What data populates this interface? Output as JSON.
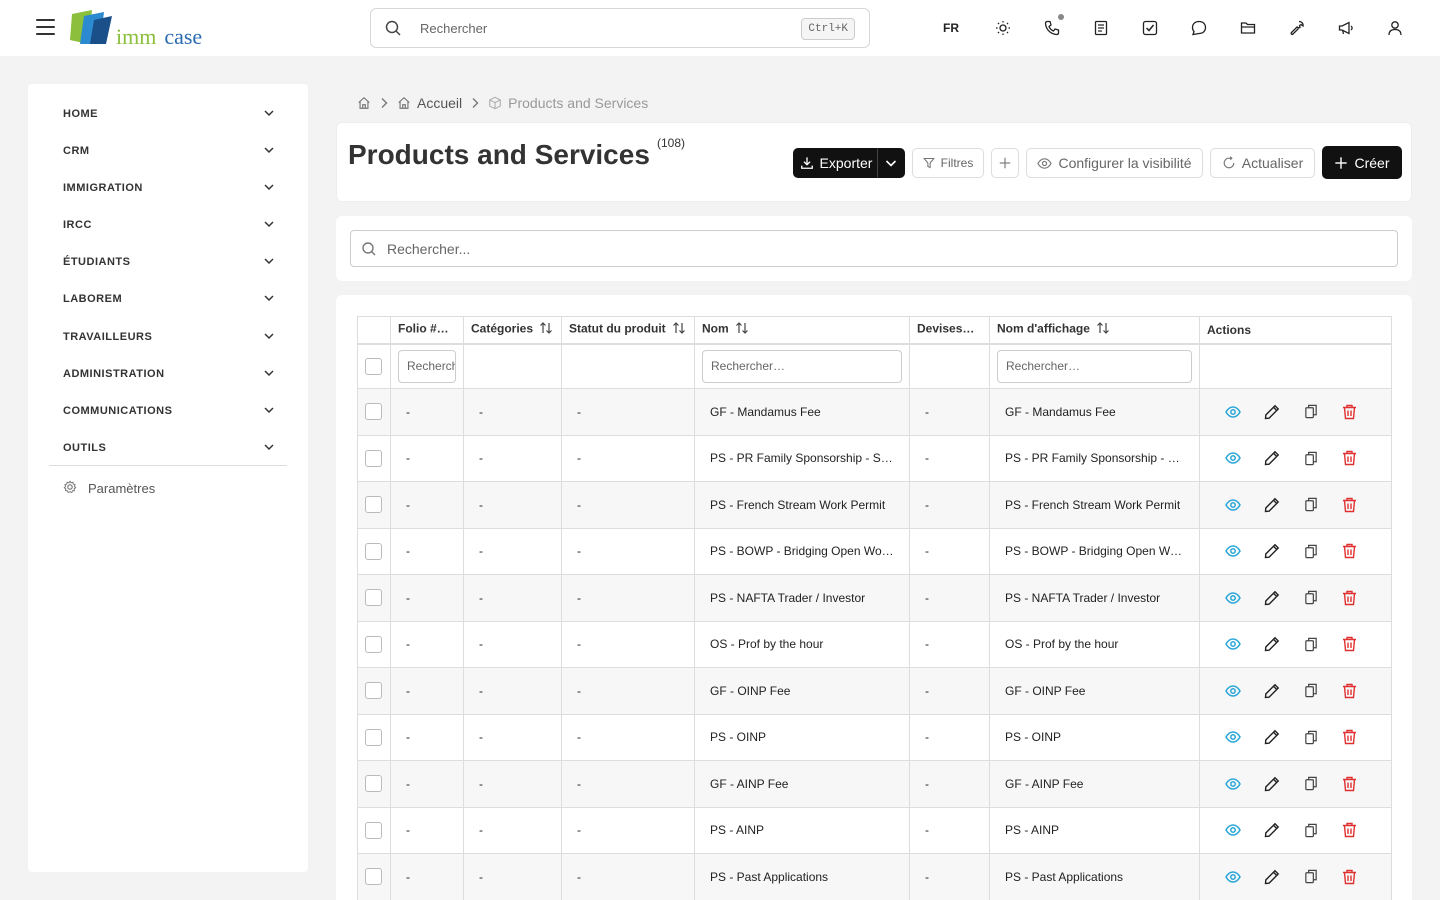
{
  "app": {
    "logo": {
      "part1": "imm",
      "part2": "case"
    },
    "search_placeholder": "Rechercher",
    "search_shortcut": "Ctrl+K",
    "language": "FR"
  },
  "sidebar": {
    "items": [
      {
        "label": "HOME"
      },
      {
        "label": "CRM"
      },
      {
        "label": "IMMIGRATION"
      },
      {
        "label": "IRCC"
      },
      {
        "label": "ÉTUDIANTS"
      },
      {
        "label": "LABOREM"
      },
      {
        "label": "TRAVAILLEURS"
      },
      {
        "label": "ADMINISTRATION"
      },
      {
        "label": "COMMUNICATIONS"
      },
      {
        "label": "OUTILS"
      }
    ],
    "settings_label": "Paramètres"
  },
  "breadcrumb": {
    "home": "Accueil",
    "current": "Products and Services"
  },
  "header": {
    "title": "Products and Services",
    "count": "(108)",
    "export_label": "Exporter",
    "filters_label": "Filtres",
    "visibility_label": "Configurer la visibilité",
    "refresh_label": "Actualiser",
    "create_label": "Créer"
  },
  "search": {
    "placeholder": "Rechercher..."
  },
  "table": {
    "columns": [
      "Folio #",
      "Catégories",
      "Statut du produit",
      "Nom",
      "Devises",
      "Nom d'affichage",
      "Actions"
    ],
    "filter_placeholders": {
      "folio": "Rechercher…",
      "nom": "Rechercher…",
      "affichage": "Rechercher…"
    },
    "rows": [
      {
        "folio": "-",
        "categories": "-",
        "statut": "-",
        "nom": "GF - Mandamus Fee",
        "devises": "-",
        "affichage": "GF - Mandamus Fee"
      },
      {
        "folio": "-",
        "categories": "-",
        "statut": "-",
        "nom": "PS - PR Family Sponsorship - Spouse",
        "devises": "-",
        "affichage": "PS - PR Family Sponsorship - Spouse"
      },
      {
        "folio": "-",
        "categories": "-",
        "statut": "-",
        "nom": "PS - French Stream Work Permit",
        "devises": "-",
        "affichage": "PS - French Stream Work Permit"
      },
      {
        "folio": "-",
        "categories": "-",
        "statut": "-",
        "nom": "PS - BOWP - Bridging Open Work Permit",
        "devises": "-",
        "affichage": "PS - BOWP - Bridging Open Work Permit"
      },
      {
        "folio": "-",
        "categories": "-",
        "statut": "-",
        "nom": "PS - NAFTA Trader / Investor",
        "devises": "-",
        "affichage": "PS - NAFTA Trader / Investor"
      },
      {
        "folio": "-",
        "categories": "-",
        "statut": "-",
        "nom": "OS - Prof by the hour",
        "devises": "-",
        "affichage": "OS - Prof by the hour"
      },
      {
        "folio": "-",
        "categories": "-",
        "statut": "-",
        "nom": "GF - OINP Fee",
        "devises": "-",
        "affichage": "GF - OINP Fee"
      },
      {
        "folio": "-",
        "categories": "-",
        "statut": "-",
        "nom": "PS - OINP",
        "devises": "-",
        "affichage": "PS - OINP"
      },
      {
        "folio": "-",
        "categories": "-",
        "statut": "-",
        "nom": "GF - AINP Fee",
        "devises": "-",
        "affichage": "GF - AINP Fee"
      },
      {
        "folio": "-",
        "categories": "-",
        "statut": "-",
        "nom": "PS - AINP",
        "devises": "-",
        "affichage": "PS - AINP"
      },
      {
        "folio": "-",
        "categories": "-",
        "statut": "-",
        "nom": "PS - Past Applications",
        "devises": "-",
        "affichage": "PS - Past Applications"
      }
    ]
  },
  "colors": {
    "view_icon": "#2aa6d8",
    "delete_icon": "#e03131",
    "primary": "#111111"
  }
}
